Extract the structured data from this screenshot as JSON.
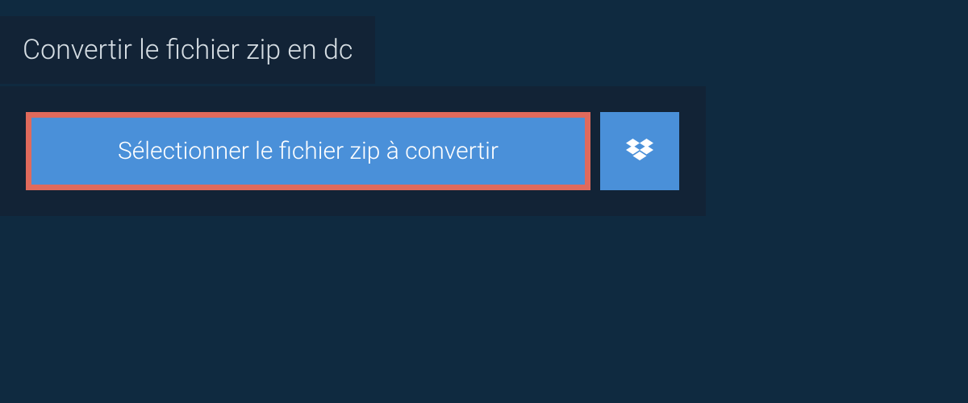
{
  "header": {
    "title": "Convertir le fichier zip en dc"
  },
  "actions": {
    "select_file_label": "Sélectionner le fichier zip à convertir"
  },
  "colors": {
    "page_bg": "#0f2a40",
    "panel_bg": "#122336",
    "button_bg": "#4a90d9",
    "highlight_border": "#e06a5c",
    "text_light": "#d5dde3",
    "text_white": "#ffffff"
  }
}
